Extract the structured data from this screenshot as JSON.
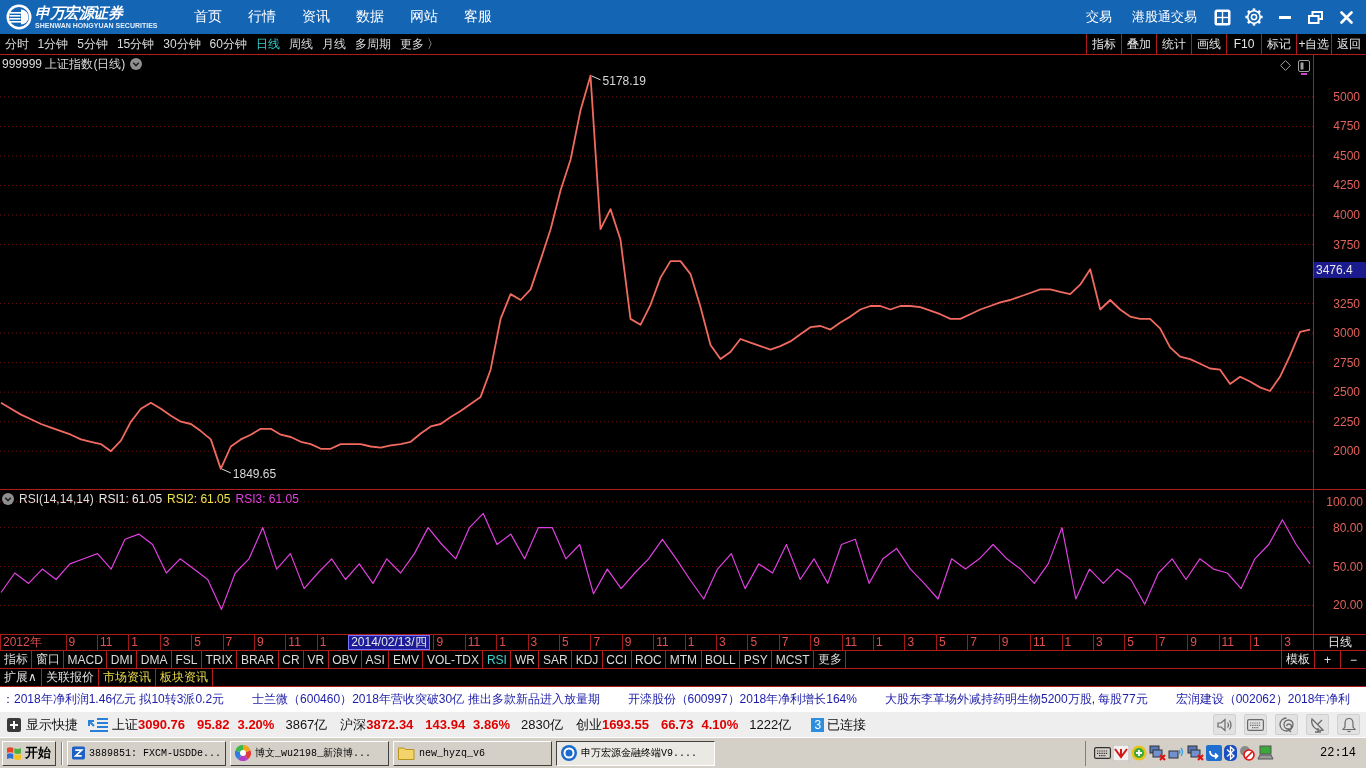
{
  "header": {
    "logo": {
      "name": "申万宏源证券",
      "tagline": "SHENWAN HONGYUAN SECURITIES"
    },
    "nav": [
      {
        "label": "首页"
      },
      {
        "label": "行情"
      },
      {
        "label": "资讯"
      },
      {
        "label": "数据"
      },
      {
        "label": "网站"
      },
      {
        "label": "客服"
      }
    ],
    "links": [
      {
        "label": "交易"
      },
      {
        "label": "港股通交易"
      }
    ]
  },
  "period_tabs": [
    {
      "label": "分时",
      "selected": false
    },
    {
      "label": "1分钟",
      "selected": false
    },
    {
      "label": "5分钟",
      "selected": false
    },
    {
      "label": "15分钟",
      "selected": false
    },
    {
      "label": "30分钟",
      "selected": false
    },
    {
      "label": "60分钟",
      "selected": false
    },
    {
      "label": "日线",
      "selected": true
    },
    {
      "label": "周线",
      "selected": false
    },
    {
      "label": "月线",
      "selected": false
    },
    {
      "label": "多周期",
      "selected": false
    },
    {
      "label": "更多 〉",
      "selected": false
    }
  ],
  "chart_tools": [
    {
      "label": "指标"
    },
    {
      "label": "叠加"
    },
    {
      "label": "统计"
    },
    {
      "label": "画线"
    },
    {
      "label": "F10"
    },
    {
      "label": "标记"
    },
    {
      "label": "+自选"
    },
    {
      "label": "返回"
    }
  ],
  "main_chart": {
    "title": "999999 上证指数(日线)",
    "cursor_value": "3476.4",
    "chart_data": {
      "type": "line",
      "series": [
        {
          "color": "#f06a60",
          "values": [
            2410,
            2360,
            2310,
            2270,
            2230,
            2200,
            2170,
            2140,
            2100,
            2080,
            2060,
            2000,
            2090,
            2250,
            2360,
            2410,
            2360,
            2300,
            2250,
            2230,
            2170,
            2100,
            1850,
            2040,
            2100,
            2140,
            2190,
            2190,
            2140,
            2120,
            2080,
            2060,
            2020,
            2020,
            2060,
            2060,
            2060,
            2040,
            2030,
            2050,
            2060,
            2080,
            2150,
            2210,
            2230,
            2290,
            2340,
            2400,
            2460,
            2690,
            3120,
            3330,
            3280,
            3370,
            3620,
            3880,
            4210,
            4470,
            4890,
            5180,
            3880,
            4050,
            3790,
            3120,
            3070,
            3240,
            3470,
            3610,
            3610,
            3500,
            3220,
            2900,
            2780,
            2840,
            2950,
            2920,
            2890,
            2860,
            2890,
            2930,
            2990,
            3050,
            3060,
            3030,
            3090,
            3140,
            3200,
            3230,
            3230,
            3200,
            3230,
            3230,
            3220,
            3190,
            3160,
            3120,
            3120,
            3160,
            3200,
            3230,
            3260,
            3280,
            3310,
            3340,
            3370,
            3370,
            3350,
            3330,
            3410,
            3540,
            3200,
            3280,
            3200,
            3140,
            3120,
            3120,
            3040,
            2880,
            2800,
            2780,
            2740,
            2700,
            2690,
            2570,
            2630,
            2590,
            2540,
            2510,
            2630,
            2810,
            3010,
            3030
          ]
        }
      ],
      "ylim": [
        1680,
        5355
      ],
      "yticks": [
        2000,
        2250,
        2500,
        2750,
        3000,
        3250,
        3750,
        4000,
        4250,
        4500,
        4750,
        5000
      ],
      "grid": true,
      "annotations": [
        "5178.19",
        "1849.65"
      ]
    }
  },
  "rsi_panel": {
    "title": "RSI(14,14,14)",
    "legend": [
      {
        "label": "RSI1: 61.05",
        "color": "#e8e8e8"
      },
      {
        "label": "RSI2: 61.05",
        "color": "#e8e84a"
      },
      {
        "label": "RSI3: 61.05",
        "color": "#e040e0"
      }
    ],
    "chart_data": {
      "type": "line",
      "series": [
        {
          "color": "#e040e0",
          "values": [
            30,
            45,
            37,
            48,
            40,
            52,
            56,
            60,
            48,
            71,
            75,
            67,
            45,
            56,
            48,
            40,
            17,
            45,
            56,
            80,
            48,
            60,
            33,
            45,
            56,
            40,
            52,
            37,
            56,
            45,
            60,
            80,
            67,
            56,
            80,
            91,
            67,
            75,
            56,
            80,
            80,
            56,
            67,
            29,
            48,
            33,
            45,
            56,
            71,
            56,
            40,
            25,
            48,
            60,
            33,
            52,
            45,
            67,
            40,
            56,
            37,
            67,
            71,
            37,
            56,
            64,
            48,
            37,
            25,
            56,
            48,
            56,
            67,
            56,
            48,
            37,
            52,
            80,
            25,
            48,
            37,
            48,
            40,
            21,
            45,
            56,
            40,
            56,
            48,
            45,
            33,
            56,
            67,
            86,
            67,
            52
          ]
        }
      ],
      "ylim": [
        -2,
        109
      ],
      "yticks": [
        {
          "value": 20,
          "label": "20.00"
        },
        {
          "value": 50,
          "label": "50.00"
        },
        {
          "value": 80,
          "label": "80.00"
        },
        {
          "value": 100,
          "label": "100.00"
        }
      ],
      "grid": true
    }
  },
  "date_axis": {
    "ticks": [
      {
        "label": "2012年",
        "kind": "year"
      },
      {
        "label": "9",
        "kind": "tick"
      },
      {
        "label": "11",
        "kind": "tick"
      },
      {
        "label": "1",
        "kind": "tick"
      },
      {
        "label": "3",
        "kind": "tick"
      },
      {
        "label": "5",
        "kind": "tick"
      },
      {
        "label": "7",
        "kind": "tick"
      },
      {
        "label": "9",
        "kind": "tick"
      },
      {
        "label": "11",
        "kind": "tick"
      },
      {
        "label": "1",
        "kind": "tick"
      },
      {
        "label": "2014/02/13/四",
        "kind": "cursor"
      },
      {
        "label": "9",
        "kind": "tick"
      },
      {
        "label": "11",
        "kind": "tick"
      },
      {
        "label": "1",
        "kind": "tick"
      },
      {
        "label": "3",
        "kind": "tick"
      },
      {
        "label": "5",
        "kind": "tick"
      },
      {
        "label": "7",
        "kind": "tick"
      },
      {
        "label": "9",
        "kind": "tick"
      },
      {
        "label": "11",
        "kind": "tick"
      },
      {
        "label": "1",
        "kind": "tick"
      },
      {
        "label": "3",
        "kind": "tick"
      },
      {
        "label": "5",
        "kind": "tick"
      },
      {
        "label": "7",
        "kind": "tick"
      },
      {
        "label": "9",
        "kind": "tick"
      },
      {
        "label": "11",
        "kind": "tick"
      },
      {
        "label": "1",
        "kind": "tick"
      },
      {
        "label": "3",
        "kind": "tick"
      },
      {
        "label": "5",
        "kind": "tick"
      },
      {
        "label": "7",
        "kind": "tick"
      },
      {
        "label": "9",
        "kind": "tick"
      },
      {
        "label": "11",
        "kind": "tick"
      },
      {
        "label": "1",
        "kind": "tick"
      },
      {
        "label": "3",
        "kind": "tick"
      },
      {
        "label": "5",
        "kind": "tick"
      },
      {
        "label": "7",
        "kind": "tick"
      },
      {
        "label": "9",
        "kind": "tick"
      },
      {
        "label": "11",
        "kind": "tick"
      },
      {
        "label": "1",
        "kind": "tick"
      },
      {
        "label": "3",
        "kind": "tick"
      }
    ],
    "period_label": "日线"
  },
  "indicator_tabs": [
    {
      "label": "指标",
      "selected": false
    },
    {
      "label": "窗口",
      "selected": false
    },
    {
      "label": "MACD",
      "selected": false
    },
    {
      "label": "DMI",
      "selected": false
    },
    {
      "label": "DMA",
      "selected": false
    },
    {
      "label": "FSL",
      "selected": false
    },
    {
      "label": "TRIX",
      "selected": false
    },
    {
      "label": "BRAR",
      "selected": false
    },
    {
      "label": "CR",
      "selected": false
    },
    {
      "label": "VR",
      "selected": false
    },
    {
      "label": "OBV",
      "selected": false
    },
    {
      "label": "ASI",
      "selected": false
    },
    {
      "label": "EMV",
      "selected": false
    },
    {
      "label": "VOL-TDX",
      "selected": false
    },
    {
      "label": "RSI",
      "selected": true
    },
    {
      "label": "WR",
      "selected": false
    },
    {
      "label": "SAR",
      "selected": false
    },
    {
      "label": "KDJ",
      "selected": false
    },
    {
      "label": "CCI",
      "selected": false
    },
    {
      "label": "ROC",
      "selected": false
    },
    {
      "label": "MTM",
      "selected": false
    },
    {
      "label": "BOLL",
      "selected": false
    },
    {
      "label": "PSY",
      "selected": false
    },
    {
      "label": "MCST",
      "selected": false
    },
    {
      "label": "更多",
      "selected": false
    }
  ],
  "panel_tools": [
    {
      "label": "模板"
    },
    {
      "label": "+"
    },
    {
      "label": "−"
    }
  ],
  "info_tabs": [
    {
      "label": "扩展∧",
      "kind": "tool"
    },
    {
      "label": "关联报价",
      "kind": "tool"
    },
    {
      "label": "市场资讯",
      "kind": "news"
    },
    {
      "label": "板块资讯",
      "kind": "news"
    }
  ],
  "news_ticker": [
    "：2018年净利润1.46亿元 拟10转3派0.2元",
    "士兰微（600460）2018年营收突破30亿 推出多款新品进入放量期",
    "开滦股份（600997）2018年净利增长164%",
    "大股东李革场外减持药明生物5200万股, 每股77元",
    "宏润建设（002062）2018年净利"
  ],
  "status_bar": {
    "shortcut": "显示快捷",
    "indices": [
      {
        "name": "上证",
        "value": "3090.76",
        "change": "95.82",
        "percent": "3.20%",
        "turnover": "3867亿"
      },
      {
        "name": "沪深",
        "value": "3872.34",
        "change": "143.94",
        "percent": "3.86%",
        "turnover": "2830亿"
      },
      {
        "name": "创业",
        "value": "1693.55",
        "change": "66.73",
        "percent": "4.10%",
        "turnover": "1222亿"
      }
    ],
    "connection": {
      "count": "3",
      "label": "已连接"
    }
  },
  "taskbar": {
    "start": "开始",
    "tasks": [
      {
        "label": "3889851: FXCM-USDDe...",
        "selected": false
      },
      {
        "label": "博文_wu2198_新浪博...",
        "selected": false
      },
      {
        "label": "new_hyzq_v6",
        "selected": false
      },
      {
        "label": "申万宏源金融终端V9....",
        "selected": true
      }
    ],
    "clock": "22:14"
  }
}
